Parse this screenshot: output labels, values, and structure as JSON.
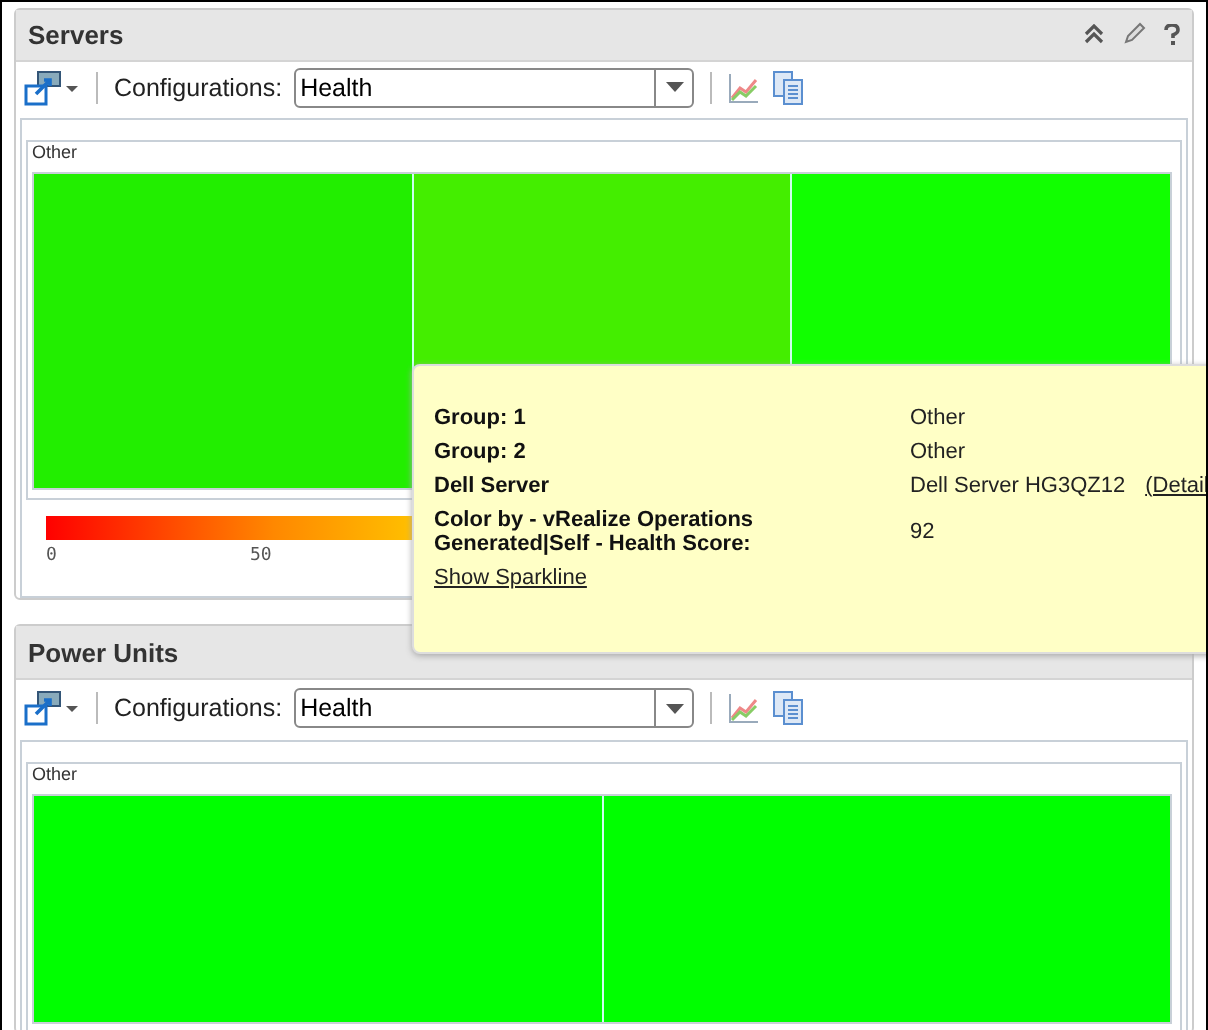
{
  "panels": [
    {
      "title": "Servers",
      "header_icons": true,
      "config_label": "Configurations:",
      "config_value": "Health",
      "group_label": "Other",
      "cells": [
        {
          "color": "#22ee00"
        },
        {
          "color": "#44ee00"
        },
        {
          "color": "#11ff00"
        }
      ],
      "legend": {
        "ticks": [
          "0",
          "50"
        ]
      }
    },
    {
      "title": "Power Units",
      "header_icons": false,
      "config_label": "Configurations:",
      "config_value": "Health",
      "group_label": "Other",
      "cells": [
        {
          "color": "#00ff00"
        },
        {
          "color": "#00ff00"
        }
      ]
    }
  ],
  "tooltip": {
    "rows": [
      {
        "label": "Group: 1",
        "value": "Other"
      },
      {
        "label": "Group: 2",
        "value": "Other"
      },
      {
        "label": "Dell Server",
        "value": "Dell Server HG3QZ12",
        "link": "(Detail"
      },
      {
        "label": "Color by - vRealize Operations Generated|Self - Health Score:",
        "value": "92"
      }
    ],
    "action": "Show Sparkline"
  }
}
